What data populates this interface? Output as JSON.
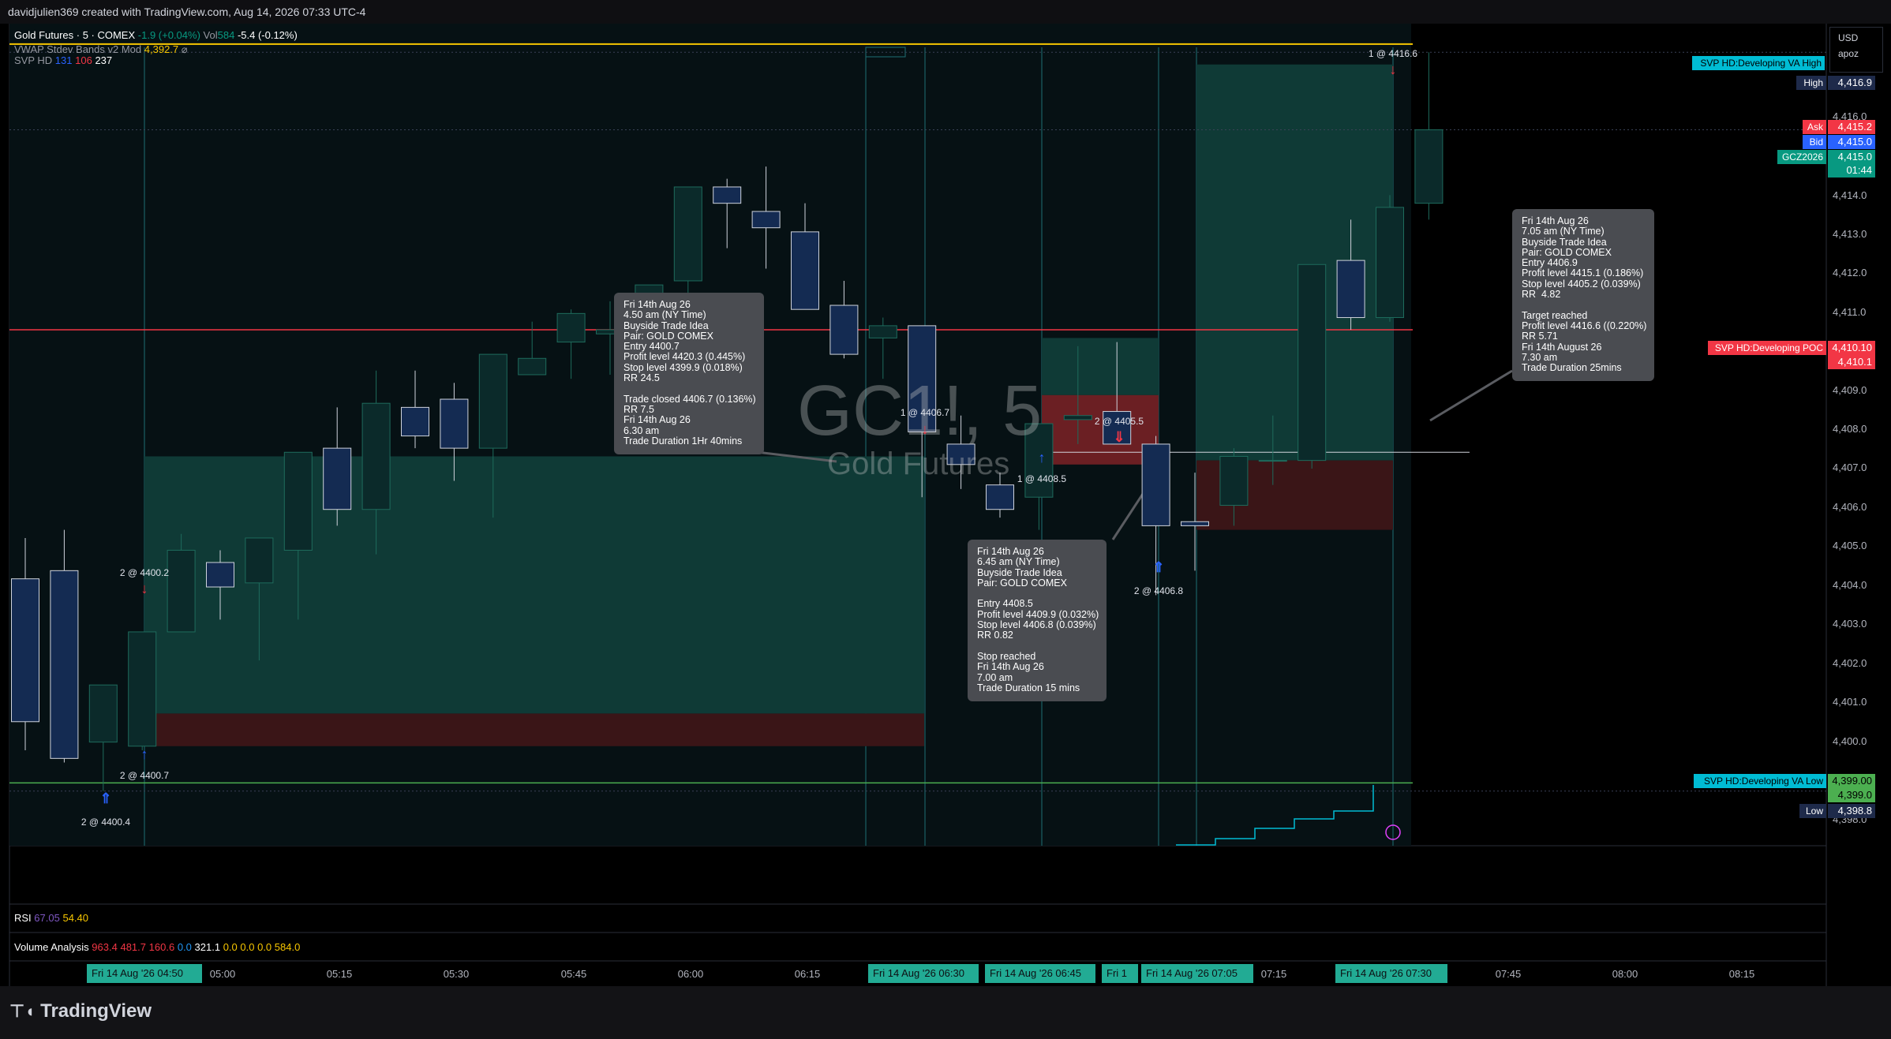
{
  "topbar": {
    "title": "davidjulien369 created with TradingView.com, Aug 14, 2026 07:33 UTC-4"
  },
  "legend": {
    "symbol": "Gold Futures · 5 · COMEX",
    "change": "-1.9 (+0.04%)",
    "vol_label": "Vol",
    "vol_value": "584",
    "vol_change": "-5.4 (-0.12%)",
    "vwap_name": "VWAP Stdev Bands v2 Mod",
    "vwap_value": "4,392.7",
    "vwap_extra": "⌀",
    "svp_name": "SVP HD",
    "svp_v1": "131",
    "svp_v2": "106",
    "svp_v3": "237"
  },
  "currency": {
    "code": "USD",
    "user": "apoz"
  },
  "watermark": {
    "ticker": "GC1!, 5",
    "name": "Gold Futures"
  },
  "rsi": {
    "label": "RSI",
    "v1": "67.05",
    "v2": "54.40"
  },
  "volume_analysis": {
    "label": "Volume Analysis",
    "values": [
      "963.4",
      "481.7",
      "160.6",
      "0.0",
      "321.1",
      "0.0",
      "0.0",
      "0.0",
      "584.0"
    ]
  },
  "price_axis": {
    "ticks": [
      "4,416.0",
      "4,414.0",
      "4,413.0",
      "4,412.0",
      "4,411.0",
      "4,409.0",
      "4,408.0",
      "4,407.0",
      "4,406.0",
      "4,405.0",
      "4,404.0",
      "4,403.0",
      "4,402.0",
      "4,401.0",
      "4,400.0",
      "4,398.0"
    ],
    "labels": {
      "high": {
        "tag": "High",
        "value": "4,416.9"
      },
      "ask": {
        "tag": "Ask",
        "value": "4,415.2"
      },
      "bid": {
        "tag": "Bid",
        "value": "4,415.0"
      },
      "last": {
        "tag": "GCZ2026",
        "value": "4,415.0",
        "countdown": "01:44"
      },
      "va_high": {
        "tag": "SVP HD:Developing VA High"
      },
      "poc": {
        "tag": "SVP HD:Developing POC",
        "value": "4,410.10",
        "value2": "4,410.1"
      },
      "va_low": {
        "tag": "SVP HD:Developing VA Low",
        "value": "4,399.00",
        "value2": "4,399.0"
      },
      "low": {
        "tag": "Low",
        "value": "4,398.8"
      }
    }
  },
  "time_axis": {
    "ticks": [
      "05:00",
      "05:15",
      "05:30",
      "05:45",
      "06:00",
      "06:15",
      "07:15",
      "07:45",
      "08:00",
      "08:15"
    ],
    "tags": [
      "Fri 14 Aug '26   04:50",
      "Fri 14 Aug '26   06:30",
      "Fri 14 Aug '26   06:45",
      "Fri 14 Aug '26   07:05",
      "Fri 14 Aug '26   07:30"
    ],
    "tag_partial": "Fri 1"
  },
  "trade_labels": [
    "1 @ 4416.6",
    "2 @ 4400.2",
    "2 @ 4400.7",
    "2 @ 4400.4",
    "1 @ 4406.7",
    "1 @ 4408.5",
    "2 @ 4405.5",
    "2 @ 4406.8"
  ],
  "tooltips": {
    "t1": "Fri 14th Aug 26\n4.50 am (NY Time)\nBuyside Trade Idea\nPair: GOLD COMEX\nEntry 4400.7\nProfit level 4420.3 (0.445%)\nStop level 4399.9 (0.018%)\nRR 24.5\n\nTrade closed 4406.7 (0.136%)\nRR 7.5\nFri 14th Aug 26\n6.30 am\nTrade Duration 1Hr 40mins",
    "t2": "Fri 14th Aug 26\n6.45 am (NY Time)\nBuyside Trade Idea\nPair: GOLD COMEX\n\nEntry 4408.5\nProfit level 4409.9 (0.032%)\nStop level 4406.8 (0.039%)\nRR 0.82\n\nStop reached\nFri 14th Aug 26\n7.00 am\nTrade Duration 15 mins",
    "t3": "Fri 14th Aug 26\n7.05 am (NY Time)\nBuyside Trade Idea\nPair: GOLD COMEX\nEntry 4406.9\nProfit level 4415.1 (0.186%)\nStop level 4405.2 (0.039%)\nRR  4.82\n\nTarget reached\nProfit level 4416.6 ((0.220%)\nRR 5.71\nFri 14th August 26\n7.30 am\nTrade Duration 25mins"
  },
  "footer": {
    "brand": "TradingView"
  },
  "chart_data": {
    "type": "candlestick",
    "symbol": "GC1!",
    "interval": "5",
    "x_start": "04:35",
    "x_step_minutes": 5,
    "ylim": [
      4397.5,
      4417.6
    ],
    "candles": [
      [
        4404.0,
        4405.0,
        4399.8,
        4400.5
      ],
      [
        4404.2,
        4405.2,
        4399.5,
        4399.6
      ],
      [
        4400.0,
        4400.8,
        4398.8,
        4401.4
      ],
      [
        4399.9,
        4402.6,
        4399.8,
        4402.7
      ],
      [
        4402.7,
        4405.1,
        4402.7,
        4404.7
      ],
      [
        4404.4,
        4404.7,
        4403.0,
        4403.8
      ],
      [
        4403.9,
        4405.0,
        4402.0,
        4405.0
      ],
      [
        4404.7,
        4407.1,
        4403.0,
        4407.1
      ],
      [
        4407.2,
        4408.2,
        4405.3,
        4405.7
      ],
      [
        4405.7,
        4409.1,
        4404.6,
        4408.3
      ],
      [
        4408.2,
        4409.1,
        4407.2,
        4407.5
      ],
      [
        4408.4,
        4408.8,
        4406.4,
        4407.2
      ],
      [
        4407.2,
        4409.4,
        4405.5,
        4409.5
      ],
      [
        4409.0,
        4410.3,
        4409.0,
        4409.4
      ],
      [
        4409.8,
        4410.6,
        4408.9,
        4410.5
      ],
      [
        4410.0,
        4410.8,
        4409.0,
        4410.1
      ],
      [
        4410.0,
        4411.2,
        4408.9,
        4411.2
      ],
      [
        4411.3,
        4413.6,
        4408.9,
        4413.6
      ],
      [
        4413.6,
        4413.8,
        4412.1,
        4413.2
      ],
      [
        4413.0,
        4414.1,
        4411.6,
        4412.6
      ],
      [
        4412.5,
        4413.2,
        4410.7,
        4410.6
      ],
      [
        4410.7,
        4411.3,
        4409.4,
        4409.5
      ],
      [
        4409.9,
        4410.4,
        4408.9,
        4410.2
      ],
      [
        4410.2,
        4410.2,
        4406.0,
        4407.6
      ],
      [
        4407.3,
        4408.0,
        4406.2,
        4406.8
      ],
      [
        4406.3,
        4406.6,
        4405.5,
        4405.7
      ],
      [
        4406.0,
        4407.7,
        4405.2,
        4407.8
      ],
      [
        4407.9,
        4409.7,
        4407.3,
        4408.0
      ],
      [
        4408.1,
        4409.8,
        4407.8,
        4407.3
      ],
      [
        4407.3,
        4407.5,
        4403.6,
        4405.3
      ],
      [
        4405.4,
        4406.6,
        4404.2,
        4405.3
      ],
      [
        4405.8,
        4407.2,
        4405.3,
        4407.0
      ],
      [
        4406.9,
        4408.0,
        4406.3,
        4406.9
      ],
      [
        4406.9,
        4411.6,
        4406.7,
        4411.7
      ],
      [
        4411.8,
        4412.8,
        4410.1,
        4410.4
      ],
      [
        4410.4,
        4413.4,
        4410.3,
        4413.1
      ],
      [
        4413.2,
        4416.9,
        4412.8,
        4415.0
      ]
    ],
    "vwap_color": "#f7c600",
    "poc_color": "#f23645",
    "va_low_color": "#4caf50"
  }
}
